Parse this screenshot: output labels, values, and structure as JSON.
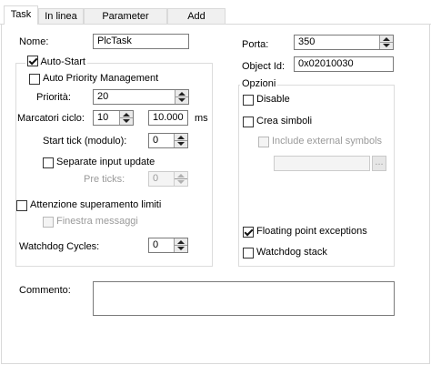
{
  "tabs": [
    {
      "label": "Task",
      "active": true
    },
    {
      "label": "In linea",
      "active": false
    },
    {
      "label": "Parameter (Online)",
      "active": false
    },
    {
      "label": "Add Symbols",
      "active": false
    }
  ],
  "left": {
    "name_label": "Nome:",
    "name_value": "PlcTask",
    "auto_start": {
      "label": "Auto-Start",
      "checked": true
    },
    "auto_priority": {
      "label": "Auto Priority Management",
      "checked": false
    },
    "priority_label": "Priorità:",
    "priority_value": "20",
    "cycle_label": "Marcatori ciclo:",
    "cycle_ticks": "10",
    "cycle_time": "10.000",
    "cycle_unit": "ms",
    "start_tick_label": "Start tick (modulo):",
    "start_tick_value": "0",
    "separate_input": {
      "label": "Separate input update",
      "checked": false
    },
    "pre_ticks_label": "Pre ticks:",
    "pre_ticks_value": "0",
    "limit_warning": {
      "label": "Attenzione superamento limiti",
      "checked": false
    },
    "message_box": {
      "label": "Finestra messaggi",
      "checked": false,
      "disabled": true
    },
    "watchdog_label": "Watchdog Cycles:",
    "watchdog_value": "0"
  },
  "right": {
    "port_label": "Porta:",
    "port_value": "350",
    "object_id_label": "Object Id:",
    "object_id_value": "0x02010030",
    "options_legend": "Opzioni",
    "disable": {
      "label": "Disable",
      "checked": false
    },
    "create_symbols": {
      "label": "Crea simboli",
      "checked": false
    },
    "include_external": {
      "label": "Include external symbols",
      "checked": false,
      "disabled": true
    },
    "symbols_path": "",
    "browse_label": "...",
    "floating_point": {
      "label": "Floating point exceptions",
      "checked": true
    },
    "watchdog_stack": {
      "label": "Watchdog stack",
      "checked": false
    }
  },
  "comment": {
    "label": "Commento:",
    "value": ""
  }
}
